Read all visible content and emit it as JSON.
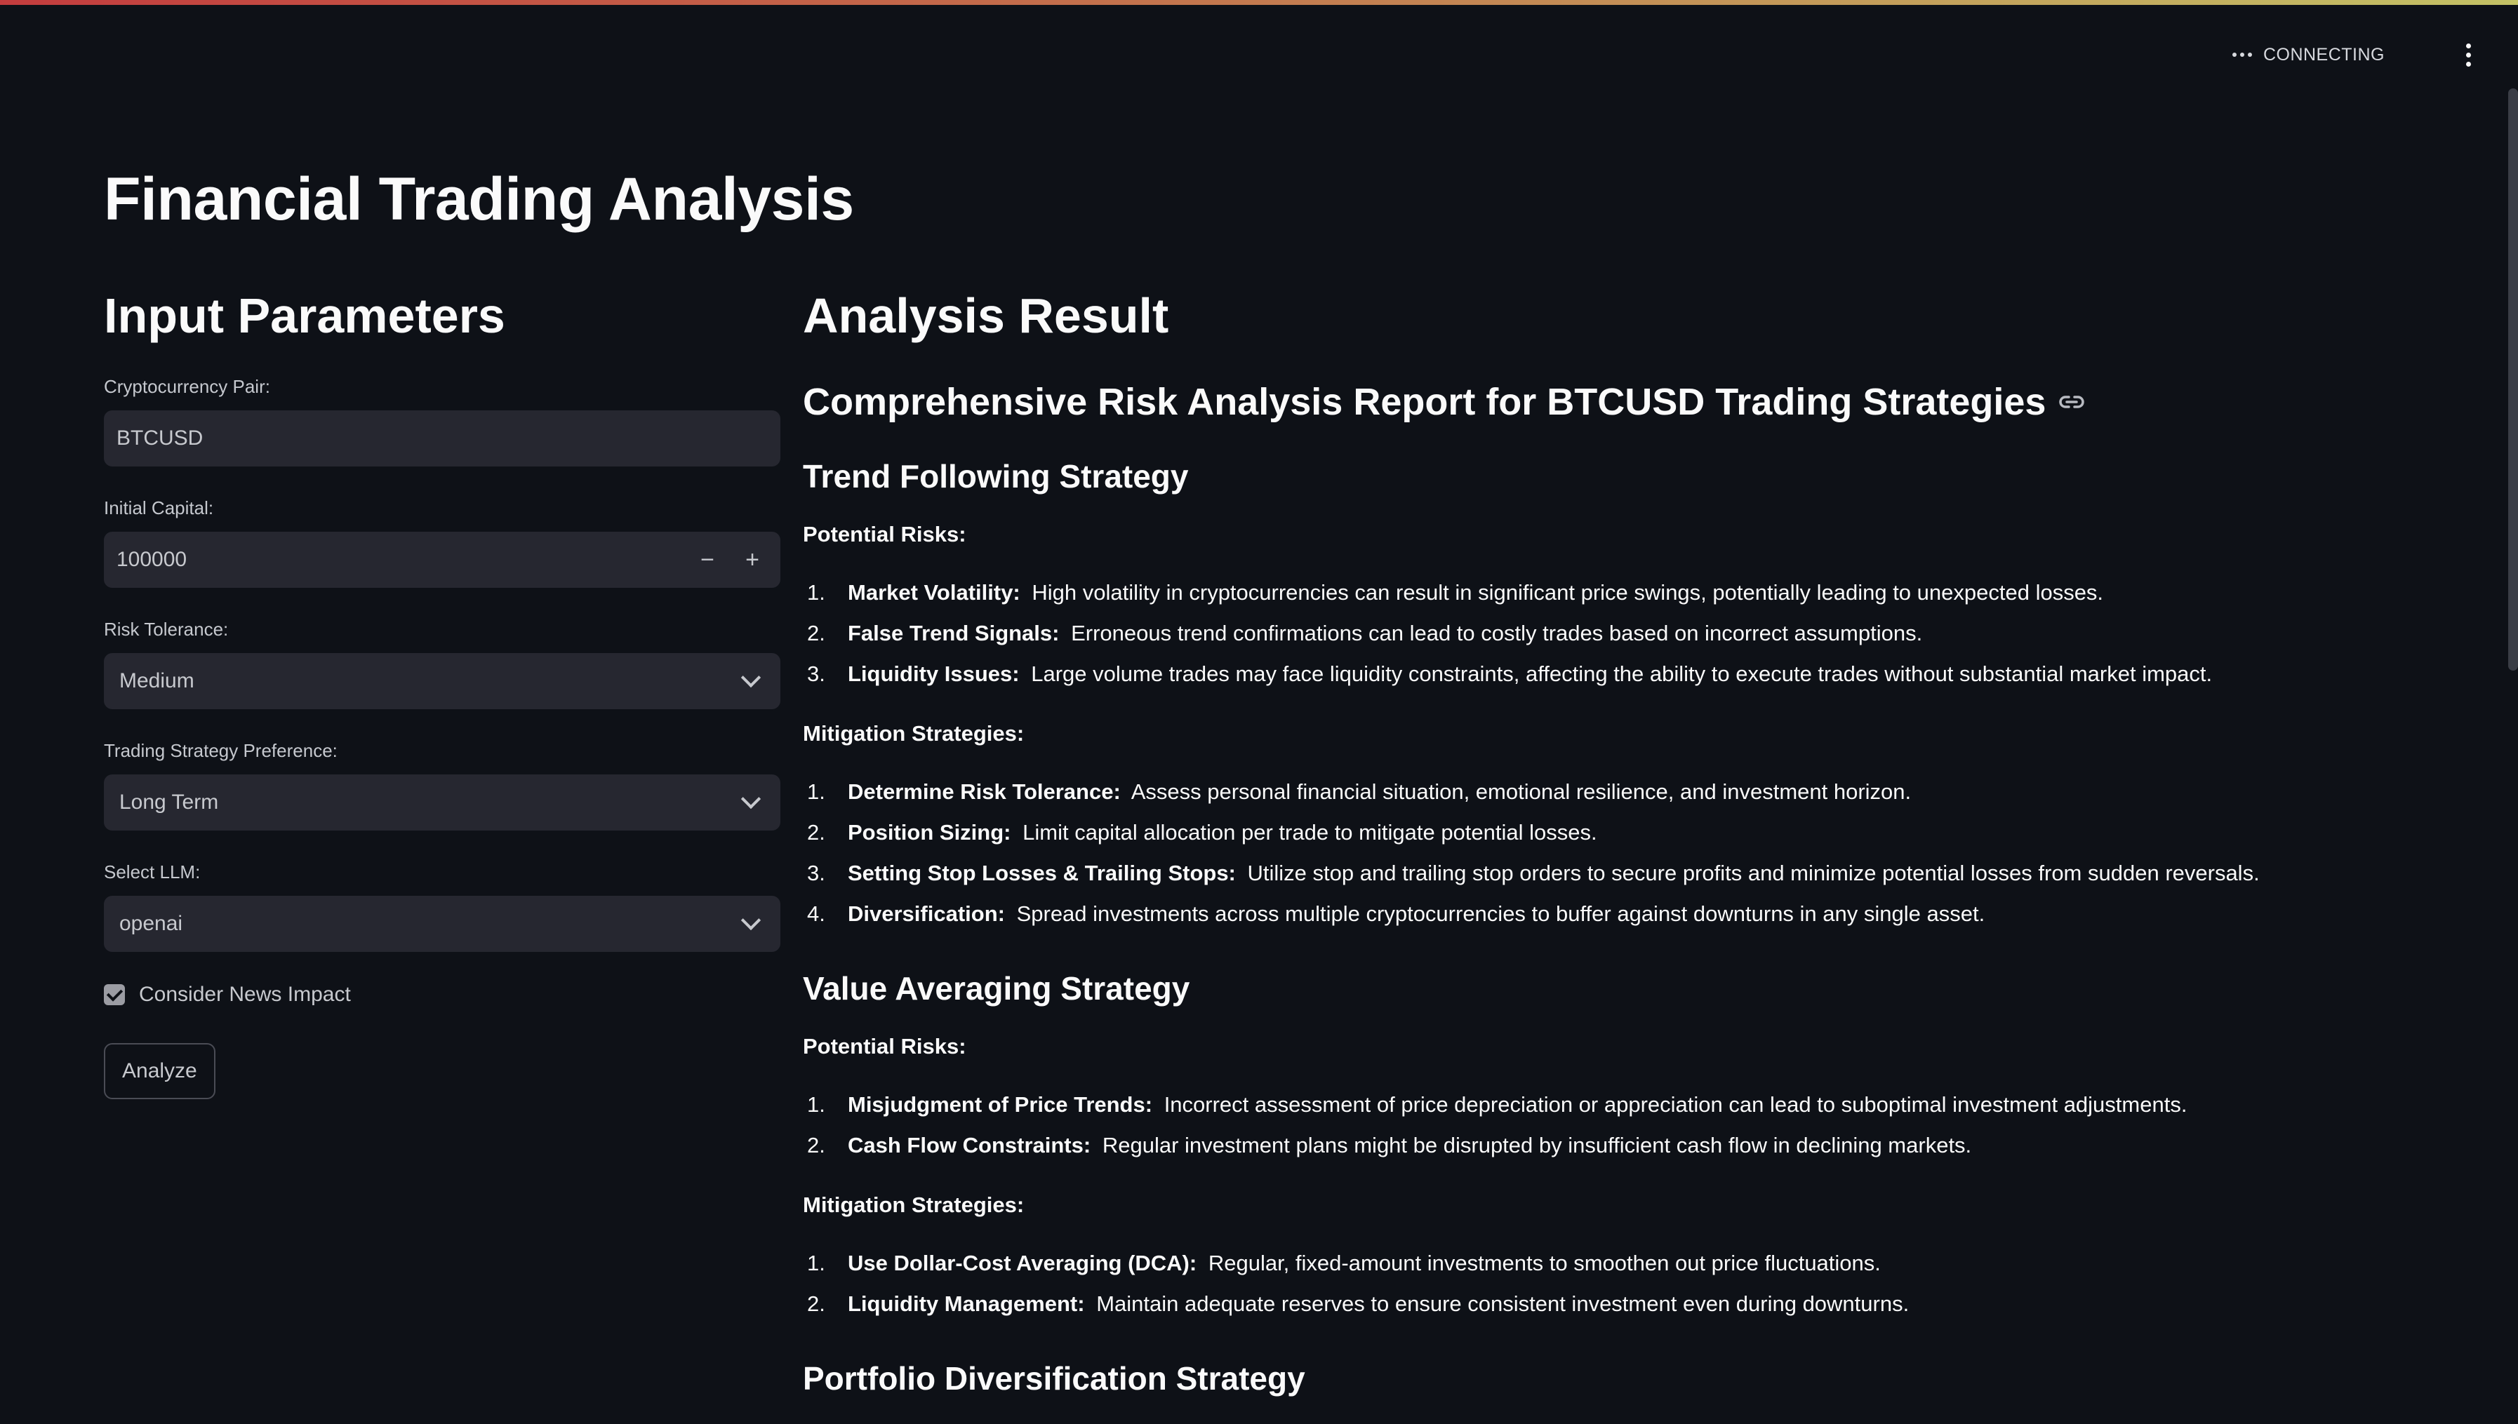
{
  "header": {
    "status": "CONNECTING"
  },
  "app_title": "Financial Trading Analysis",
  "inputs": {
    "heading": "Input Parameters",
    "crypto_pair": {
      "label": "Cryptocurrency Pair:",
      "value": "BTCUSD"
    },
    "initial_capital": {
      "label": "Initial Capital:",
      "value": "100000",
      "minus": "−",
      "plus": "+"
    },
    "risk_tolerance": {
      "label": "Risk Tolerance:",
      "value": "Medium"
    },
    "strategy_pref": {
      "label": "Trading Strategy Preference:",
      "value": "Long Term"
    },
    "llm": {
      "label": "Select LLM:",
      "value": "openai"
    },
    "news_impact": {
      "label": "Consider News Impact",
      "checked": true
    },
    "analyze_button": "Analyze"
  },
  "result": {
    "heading": "Analysis Result",
    "report_title": "Comprehensive Risk Analysis Report for BTCUSD Trading Strategies",
    "strategies": [
      {
        "title": "Trend Following Strategy",
        "risks_label": "Potential Risks:",
        "risks": [
          {
            "n": "1.",
            "term": "Market Volatility:",
            "text": "High volatility in cryptocurrencies can result in significant price swings, potentially leading to unexpected losses."
          },
          {
            "n": "2.",
            "term": "False Trend Signals:",
            "text": "Erroneous trend confirmations can lead to costly trades based on incorrect assumptions."
          },
          {
            "n": "3.",
            "term": "Liquidity Issues:",
            "text": "Large volume trades may face liquidity constraints, affecting the ability to execute trades without substantial market impact."
          }
        ],
        "mitigation_label": "Mitigation Strategies:",
        "mitigations": [
          {
            "n": "1.",
            "term": "Determine Risk Tolerance:",
            "text": "Assess personal financial situation, emotional resilience, and investment horizon."
          },
          {
            "n": "2.",
            "term": "Position Sizing:",
            "text": "Limit capital allocation per trade to mitigate potential losses."
          },
          {
            "n": "3.",
            "term": "Setting Stop Losses & Trailing Stops:",
            "text": "Utilize stop and trailing stop orders to secure profits and minimize potential losses from sudden reversals."
          },
          {
            "n": "4.",
            "term": "Diversification:",
            "text": "Spread investments across multiple cryptocurrencies to buffer against downturns in any single asset."
          }
        ]
      },
      {
        "title": "Value Averaging Strategy",
        "risks_label": "Potential Risks:",
        "risks": [
          {
            "n": "1.",
            "term": "Misjudgment of Price Trends:",
            "text": "Incorrect assessment of price depreciation or appreciation can lead to suboptimal investment adjustments."
          },
          {
            "n": "2.",
            "term": "Cash Flow Constraints:",
            "text": "Regular investment plans might be disrupted by insufficient cash flow in declining markets."
          }
        ],
        "mitigation_label": "Mitigation Strategies:",
        "mitigations": [
          {
            "n": "1.",
            "term": "Use Dollar-Cost Averaging (DCA):",
            "text": "Regular, fixed-amount investments to smoothen out price fluctuations."
          },
          {
            "n": "2.",
            "term": "Liquidity Management:",
            "text": "Maintain adequate reserves to ensure consistent investment even during downturns."
          }
        ]
      }
    ],
    "next_strategy_title": "Portfolio Diversification Strategy"
  }
}
